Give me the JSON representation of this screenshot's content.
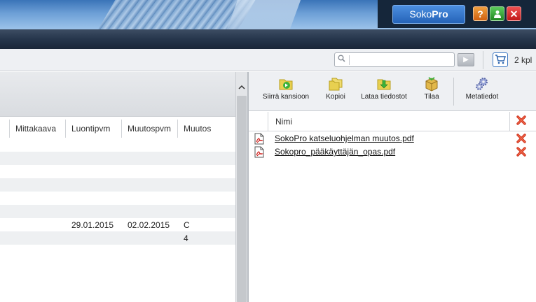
{
  "header": {
    "logo_text": "Soko",
    "logo_bold": "Pro",
    "help_label": "?",
    "user_label": "👤",
    "close_label": "✕"
  },
  "search": {
    "placeholder": "",
    "value": "",
    "go_label": "▶"
  },
  "cart": {
    "icon": "cart-icon",
    "count_label": "2 kpl"
  },
  "table": {
    "columns": [
      "Mittakaava",
      "Luontipvm",
      "Muutospvm",
      "Muutos"
    ],
    "rows": [
      [
        "",
        "",
        "",
        ""
      ],
      [
        "",
        "",
        "",
        ""
      ],
      [
        "",
        "",
        "",
        ""
      ],
      [
        "",
        "",
        "",
        ""
      ],
      [
        "",
        "",
        "",
        ""
      ],
      [
        "",
        "",
        "",
        ""
      ],
      [
        "",
        "29.01.2015",
        "02.02.2015",
        "C"
      ],
      [
        "",
        "",
        "",
        "4"
      ]
    ]
  },
  "actions": {
    "move": "Siirrä kansioon",
    "copy": "Kopioi",
    "download": "Lataa tiedostot",
    "order": "Tilaa",
    "metadata": "Metatiedot"
  },
  "files": {
    "column_name": "Nimi",
    "items": [
      {
        "name": "SokoPro katseluohjelman muutos.pdf"
      },
      {
        "name": "Sokopro_pääkäyttäjän_opas.pdf"
      }
    ]
  },
  "colors": {
    "navbar": "#26364c",
    "accent": "#2563b8",
    "delete": "#d0301c"
  }
}
